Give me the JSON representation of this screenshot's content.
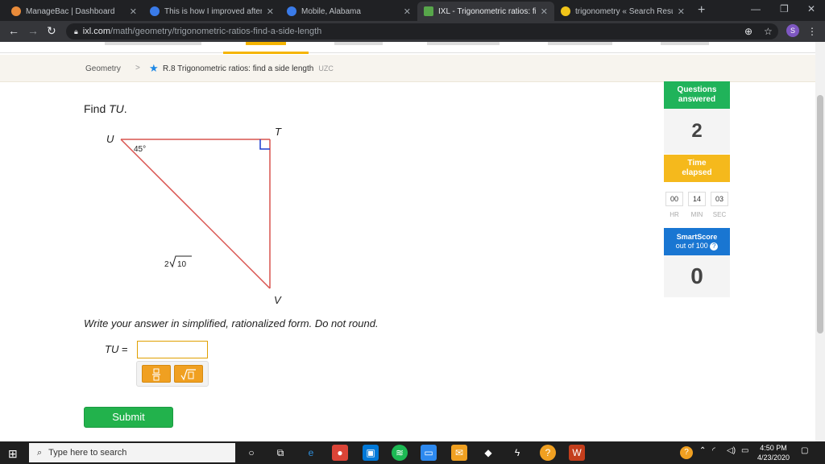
{
  "browser": {
    "tabs": [
      {
        "title": "ManageBac | Dashboard",
        "fav_color": "#e98b3a"
      },
      {
        "title": "This is how I improved after 1",
        "fav_color": "#3a7be9"
      },
      {
        "title": "Mobile, Alabama",
        "fav_color": "#3a7be9"
      },
      {
        "title": "IXL - Trigonometric ratios: find",
        "fav_color": "#57a64a"
      },
      {
        "title": "trigonometry « Search Results",
        "fav_color": "#f0c419"
      }
    ],
    "close_glyph": "✕",
    "new_tab_glyph": "+",
    "url_host": "ixl.com",
    "url_path": "/math/geometry/trigonometric-ratios-find-a-side-length",
    "profile_initial": "S"
  },
  "breadcrumb": {
    "subject": "Geometry",
    "separator": ">",
    "skill": "R.8 Trigonometric ratios: find a side length",
    "code": "UZC"
  },
  "problem": {
    "prompt_prefix": "Find ",
    "prompt_var": "TU",
    "prompt_suffix": ".",
    "vertex_u": "U",
    "vertex_t": "T",
    "vertex_v": "V",
    "angle_label": "45°",
    "hyp_coef": "2",
    "hyp_radicand": "10",
    "instruction": "Write your answer in simplified, rationalized form. Do not round.",
    "answer_var": "TU",
    "answer_eq": " =",
    "answer_value": "",
    "tool_fraction": "fraction-icon",
    "tool_sqrt": "sqrt-icon",
    "submit_label": "Submit"
  },
  "stats": {
    "questions_answered_label_1": "Questions",
    "questions_answered_label_2": "answered",
    "questions_answered": "2",
    "time_elapsed_label_1": "Time",
    "time_elapsed_label_2": "elapsed",
    "time_hr": "00",
    "time_min": "14",
    "time_sec": "03",
    "unit_hr": "HR",
    "unit_min": "MIN",
    "unit_sec": "SEC",
    "smartscore_label": "SmartScore",
    "smartscore_sub": "out of 100",
    "smartscore": "0"
  },
  "taskbar": {
    "search_placeholder": "Type here to search",
    "time": "4:50 PM",
    "date": "4/23/2020"
  },
  "colors": {
    "triangle": "#d9534f",
    "right_angle": "#1a3ccf",
    "accent_green": "#20b35a",
    "accent_yellow": "#f5b91c",
    "accent_blue": "#1976d2"
  }
}
